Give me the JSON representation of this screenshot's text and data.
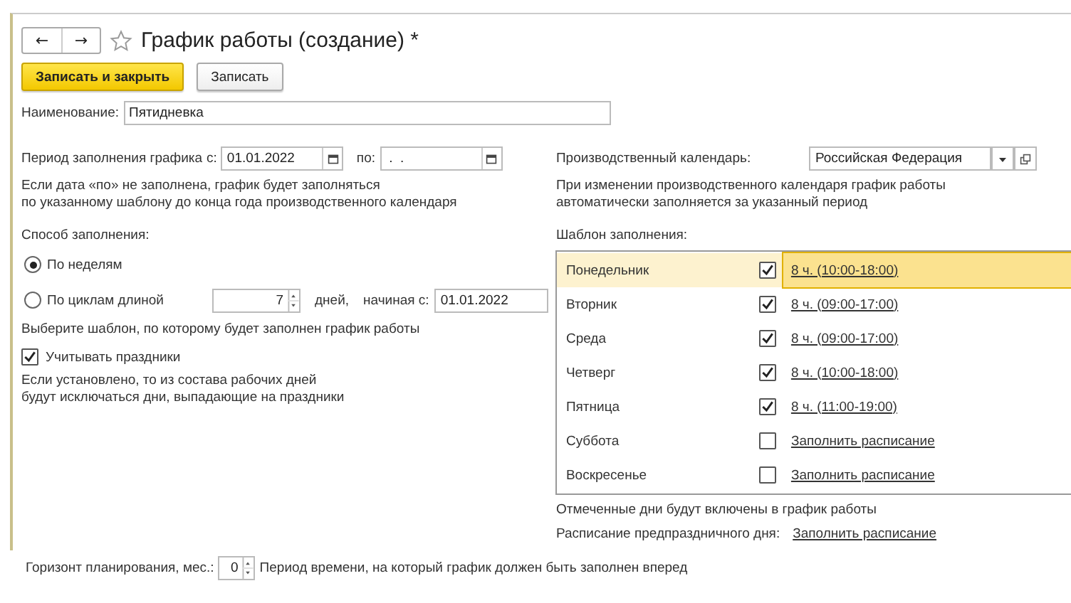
{
  "window": {
    "title": "График работы (создание) *",
    "back": "←",
    "forward": "→",
    "favorite": false
  },
  "buttons": [
    {
      "label": "Записать и закрыть",
      "primary": true
    },
    {
      "label": "Записать",
      "primary": false
    }
  ],
  "name_field": {
    "label": "Наименование:",
    "value": "Пятидневка"
  },
  "period": {
    "label": "Период заполнения графика",
    "from_label": "с:",
    "from_value": "01.01.2022",
    "to_label": "по:",
    "to_value": " .  ."
  },
  "period_note": "Если дата «по» не заполнена, график будет заполняться\nпо указанному шаблону до конца года производственного календаря",
  "fill_method": {
    "label": "Способ заполнения:",
    "options": [
      {
        "label": "По неделям",
        "selected": true
      },
      {
        "label": "По циклам длиной",
        "selected": false
      }
    ],
    "cycle_length": "7",
    "days_label": "дней,",
    "start_label": "начиная с:",
    "start_value": "01.01.2022"
  },
  "template_hint": "Выберите шаблон, по которому будет заполнен график работы",
  "holidays": {
    "label": "Учитывать праздники",
    "checked": true,
    "note": "Если установлено, то из состава рабочих дней\nбудут исключаться дни, выпадающие на праздники"
  },
  "calendar": {
    "label": "Производственный календарь:",
    "value": "Российская Федерация",
    "note": "При изменении производственного календаря график работы\nавтоматически заполняется за указанный период"
  },
  "template": {
    "label": "Шаблон заполнения:",
    "days": [
      {
        "name": "Понедельник",
        "checked": true,
        "schedule": "8 ч. (10:00-18:00)",
        "selected": true
      },
      {
        "name": "Вторник",
        "checked": true,
        "schedule": "8 ч. (09:00-17:00)",
        "selected": false
      },
      {
        "name": "Среда",
        "checked": true,
        "schedule": "8 ч. (09:00-17:00)",
        "selected": false
      },
      {
        "name": "Четверг",
        "checked": true,
        "schedule": "8 ч. (10:00-18:00)",
        "selected": false
      },
      {
        "name": "Пятница",
        "checked": true,
        "schedule": "8 ч. (11:00-19:00)",
        "selected": false
      },
      {
        "name": "Суббота",
        "checked": false,
        "schedule": "Заполнить расписание",
        "selected": false
      },
      {
        "name": "Воскресенье",
        "checked": false,
        "schedule": "Заполнить расписание",
        "selected": false
      }
    ]
  },
  "marked_note": "Отмеченные дни будут включены в график работы",
  "preholiday": {
    "label": "Расписание предпраздничного дня:",
    "link": "Заполнить расписание"
  },
  "horizon": {
    "label": "Горизонт планирования, мес.:",
    "value": "0",
    "note": "Период времени, на который график должен быть заполнен вперед"
  }
}
